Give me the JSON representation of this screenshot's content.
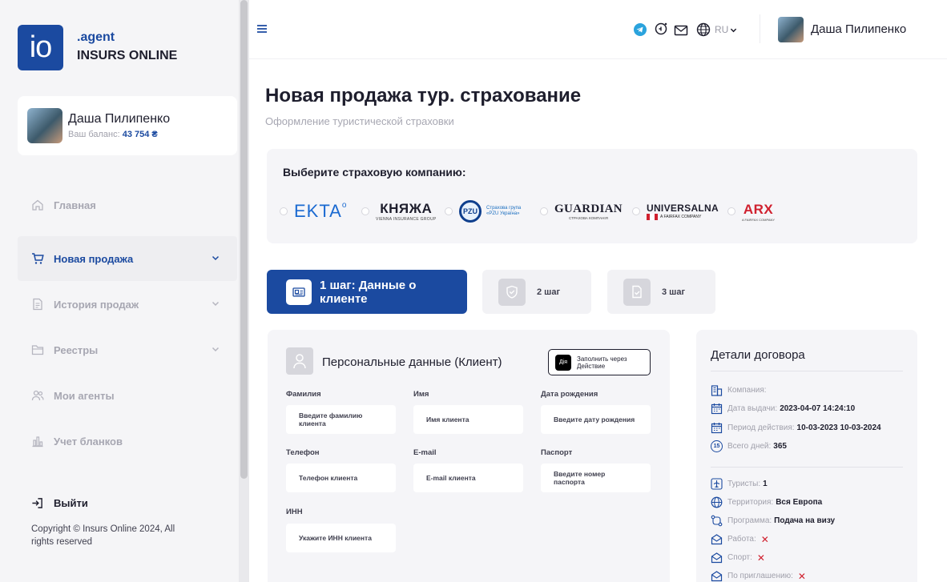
{
  "brand": {
    "logo_text": "io",
    "agent": ".agent",
    "name": "INSURS ONLINE"
  },
  "user": {
    "name": "Даша Пилипенко",
    "balance_label": "Ваш баланс:",
    "balance_value": "43 754 ₴"
  },
  "nav": [
    {
      "label": "Главная",
      "icon": "home-icon"
    },
    {
      "label": "Новая продажа",
      "icon": "cart-icon"
    },
    {
      "label": "История продаж",
      "icon": "document-icon"
    },
    {
      "label": "Реестры",
      "icon": "folder-icon"
    },
    {
      "label": "Мои агенты",
      "icon": "users-icon"
    },
    {
      "label": "Учет бланков",
      "icon": "chart-icon"
    }
  ],
  "logout": "Выйти",
  "copyright": "Copyright © Insurs Online 2024, All rights reserved",
  "topbar": {
    "lang": "RU",
    "user_name": "Даша Пилипенко"
  },
  "page": {
    "title": "Новая продажа тур. страхование",
    "subtitle": "Оформление туристической страховки"
  },
  "companies": {
    "title": "Выберите страховую компанию:",
    "ekta": "EKTA",
    "kniazha_main": "КНЯЖА",
    "kniazha_sub": "VIENNA INSURANCE GROUP",
    "pzu_badge": "PZU",
    "pzu_sub": "Страхова група «PZU Україна»",
    "guardian_main": "GUARDIAN",
    "guardian_sub": "СТРАХОВА КОМПАНІЯ",
    "universalna_main": "UNIVERSALNA",
    "universalna_sub": "A FAIRFAX COMPANY",
    "arx_main": "ARX",
    "arx_sub": "A FAIRFAX COMPANY"
  },
  "steps": [
    {
      "label": "1 шаг: Данные о клиенте"
    },
    {
      "label": "2 шаг"
    },
    {
      "label": "3 шаг"
    }
  ],
  "form": {
    "title": "Персональные данные (Клиент)",
    "diia_logo": "Дія",
    "diia_label": "Заполнить через Действие",
    "fields": [
      {
        "label": "Фамилия",
        "placeholder": "Введите фамилию клиента"
      },
      {
        "label": "Имя",
        "placeholder": "Имя клиента"
      },
      {
        "label": "Дата рождения",
        "placeholder": "Введите дату рождения"
      },
      {
        "label": "Телефон",
        "placeholder": "Телефон клиента"
      },
      {
        "label": "E-mail",
        "placeholder": "E-mail клиента"
      },
      {
        "label": "Паспорт",
        "placeholder": "Введите номер паспорта"
      },
      {
        "label": "ИНН",
        "placeholder": "Укажите ИНН клиента"
      }
    ]
  },
  "details": {
    "title": "Детали договора",
    "company_label": "Компания:",
    "company_value": "",
    "issue_label": "Дата выдачи:",
    "issue_value": "2023-04-07 14:24:10",
    "period_label": "Период действия:",
    "period_value": "10-03-2023 10-03-2024",
    "days_label": "Всего дней:",
    "days_value": "365",
    "days_badge": "15",
    "tourists_label": "Туристы:",
    "tourists_value": "1",
    "territory_label": "Территория:",
    "territory_value": "Вся Европа",
    "program_label": "Программа:",
    "program_value": "Подача на визу",
    "work_label": "Работа:",
    "sport_label": "Спорт:",
    "invite_label": "По приглашению:",
    "no_mark": "✕"
  },
  "colors": {
    "primary": "#1b4aa0",
    "danger": "#d0202e",
    "bg_panel": "#f5f5f8"
  }
}
